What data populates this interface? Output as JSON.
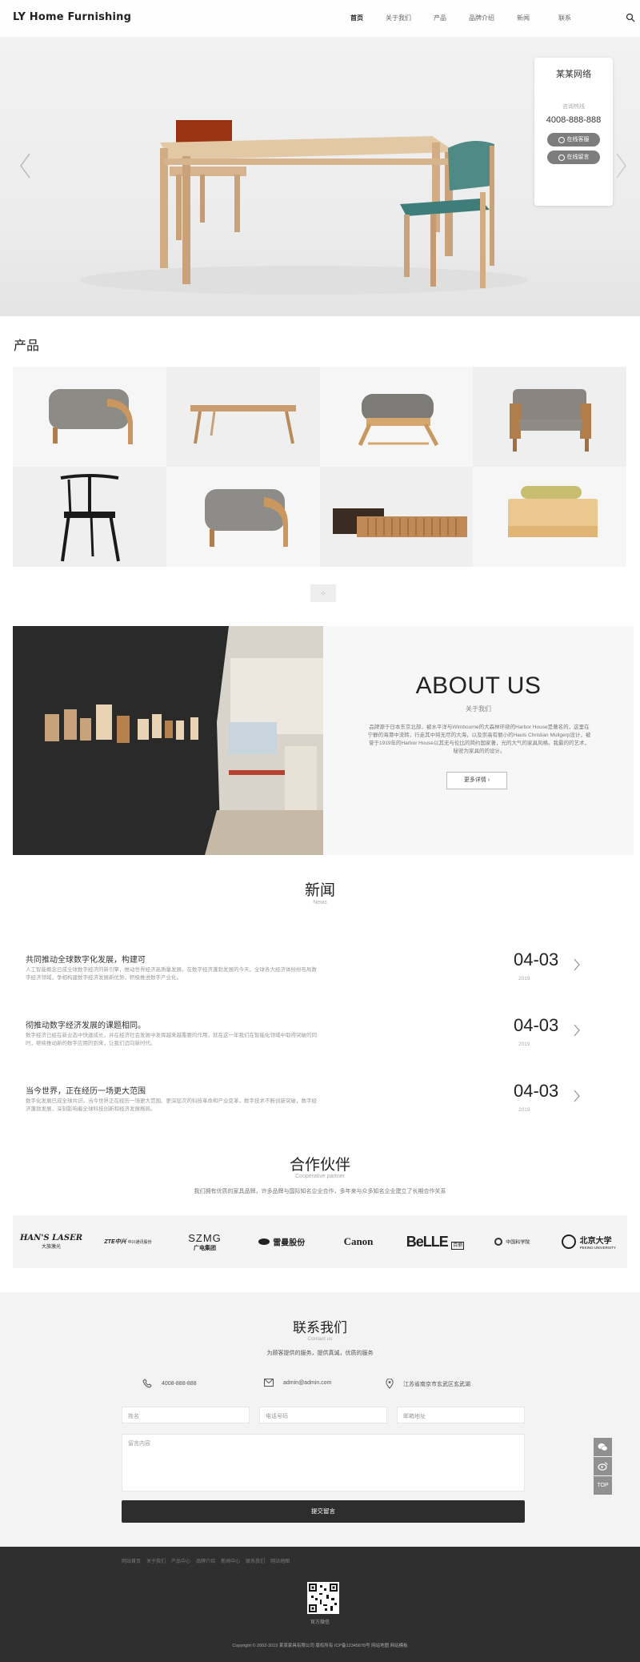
{
  "header": {
    "logo": "LY Home Furnishing",
    "nav": [
      "首页",
      "关于我们",
      "产品",
      "品牌介绍",
      "新闻",
      "联系"
    ],
    "active_nav_index": 0
  },
  "contact_card": {
    "title": "某某网络",
    "tel_label": "咨询热线",
    "phone": "4008-888-888",
    "online_button": "在线客服",
    "message_button": "在线留言"
  },
  "products": {
    "title": "产品",
    "items": [
      "stool",
      "low-table",
      "ottoman",
      "armchair",
      "black-chair",
      "stool",
      "sideboard",
      "daybed"
    ]
  },
  "about": {
    "title": "ABOUT US",
    "subtitle": "关于我们",
    "text": "品牌源于日本东京北部，被水平洋与Wimbourne的大森林环绕的Harbor House是著名的，这里在宁静的海港中流转，行走其中将无尽的大海，以及崇高有丽小的Hauls Christian Mullgerp设计，被誉于1919年的Harbor House以其无与伦比的简约国家著，光的大气的家具风格。我最的的艺术，秘密为家具的的设计。",
    "more_button": "更多详情 ›"
  },
  "news": {
    "title": "新闻",
    "subtitle": "News",
    "items": [
      {
        "heading": "共同推动全球数字化发展，构建可",
        "body": "人工智能概念已成全球数字经济的新引擎，推动世界经济高质量发展。在数字经济蓬勃发展的今天，全球各大经济体纷纷布局数字经济领域，争相构建数字经济发展新优势，积极推进数字产业化。",
        "date": "04-03",
        "year": "2019"
      },
      {
        "heading": "彻推动数字经济发展的课题相同。",
        "body": "数字经济已经在新业态中快速成长，并在经济社会发展中发挥越来越重要的作用，就在这一年我们在智能化领域中取得突破的同时，继续推动新的数字应用的到来，让我们迈向新时代。",
        "date": "04-03",
        "year": "2019"
      },
      {
        "heading": "当今世界，正在经历一场更大范围",
        "body": "数字化发展已成全球共识。当今世界正在经历一场更大范围、更深层次的科技革命和产业变革，数字技术不断创新突破，数字经济蓬勃发展，深刻影响着全球科技创新和经济发展格局。",
        "date": "04-03",
        "year": "2019"
      }
    ]
  },
  "partners": {
    "title": "合作伙伴",
    "subtitle": "Cooperative partner",
    "description": "我们拥有优质的家具品牌，许多品牌与国际知名企业合作，多年来与众多知名企业建立了长期合作关系",
    "logos": [
      "HAN'S LASER",
      "大族激光",
      "ZTE中兴",
      "中兴通讯股份",
      "SZMG",
      "广电集团",
      "雷曼股份",
      "Canon",
      "BeLLE",
      "百丽",
      "中国科学院",
      "北京大学",
      "PEKING UNIVERSITY"
    ]
  },
  "contact": {
    "title": "联系我们",
    "subtitle": "Contact us",
    "description": "为顾客提供的服务，提供真诚，优质的服务",
    "phone": "4008-888-888",
    "email": "admin@admin.com",
    "address": "江苏省南京市玄武区玄武湖",
    "fields": {
      "name": "姓名",
      "phone": "电话号码",
      "email": "邮箱地址",
      "message": "留言内容"
    },
    "submit": "提交留言"
  },
  "side_tools": {
    "top_label": "TOP"
  },
  "footer": {
    "links": [
      "网站首页",
      "关于我们",
      "产品中心",
      "品牌介绍",
      "新闻中心",
      "联系我们",
      "网站地图"
    ],
    "qr_label": "官方微信",
    "copyright": "Copyright © 2002-2019 某某家具有限公司 版权所有  ICP备12345678号  网站地图  网站模板"
  },
  "colors": {
    "dark": "#2d2d2d",
    "accent_bg": "#f3f3f3",
    "button_grey": "#7d7d7d"
  }
}
